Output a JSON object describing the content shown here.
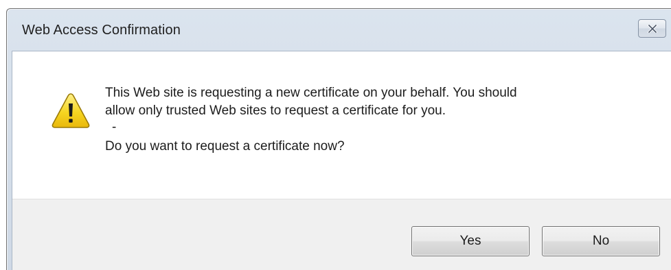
{
  "dialog": {
    "title": "Web Access Confirmation",
    "close_icon": "close-x-icon",
    "warning_icon": "warning-triangle-icon",
    "message_line1": "This Web site is requesting a new certificate on your behalf. You should",
    "message_line2": "allow only trusted Web sites to request a certificate for you.",
    "separator": "-",
    "question": "Do you want to request a certificate now?",
    "buttons": {
      "yes_label": "Yes",
      "no_label": "No"
    }
  },
  "colors": {
    "titlebar": "#d4deea",
    "footer": "#f0f0f0",
    "warning_yellow": "#f5d320",
    "warning_outline": "#9a7a08"
  }
}
